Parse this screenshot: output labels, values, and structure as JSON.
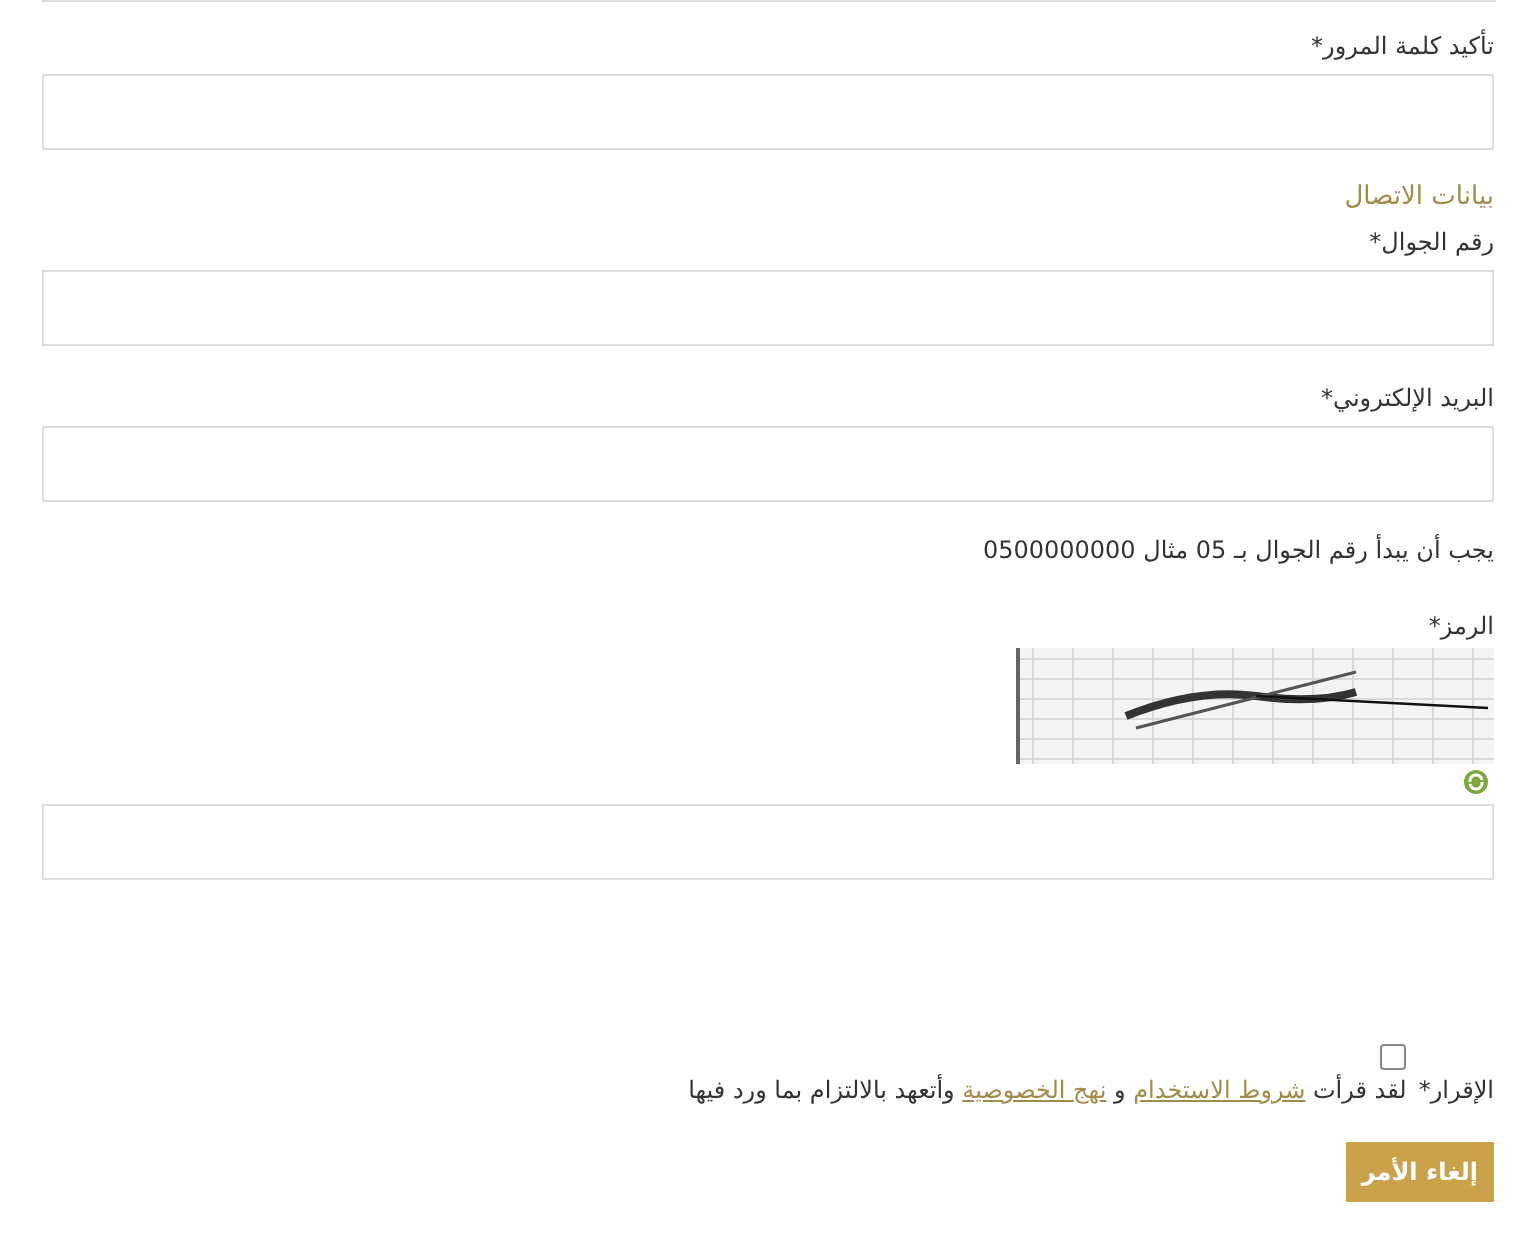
{
  "fields_top": [
    {
      "label": "تأكيد كلمة المرور*"
    }
  ],
  "contact_heading": "بيانات الاتصال",
  "contact_fields": [
    {
      "label": "رقم الجوال*"
    },
    {
      "label": "البريد الإلكتروني*"
    }
  ],
  "hint": "يجب أن يبدأ رقم الجوال بـ 05 مثال 0500000000",
  "captcha": {
    "label": "الرمز*"
  },
  "agreement": {
    "label": "الإقرار*",
    "checked": false,
    "text_before": "لقد قرأت ",
    "link_1": "شروط الاستخدام",
    "text_middle": " و ",
    "link_2": "نهج الخصوصية",
    "text_after": " وأتعهد بالالتزام بما ورد فيها"
  },
  "submit_button": "إلغاء الأمر"
}
